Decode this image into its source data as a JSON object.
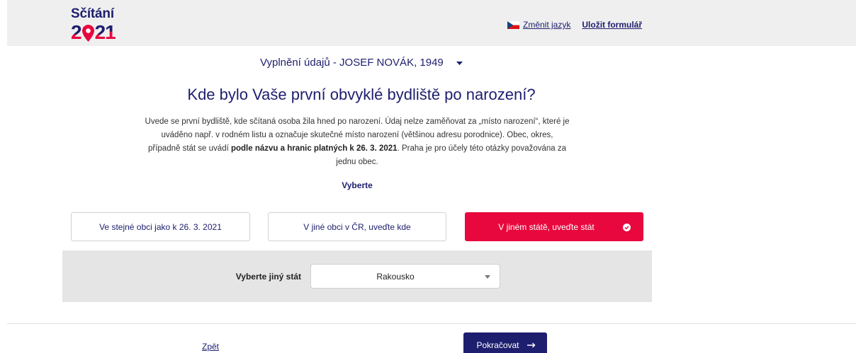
{
  "colors": {
    "primary": "#1e1e6e",
    "accent": "#e8083e",
    "panel": "#e5e5e5",
    "header": "#efefef"
  },
  "header": {
    "logo": {
      "title": "Sčítání",
      "year_digits": [
        "2",
        "0",
        "2",
        "1"
      ],
      "pin_icon": "location-pin-icon"
    },
    "language_icon": "czech-flag-icon",
    "change_language_label": "Změnit jazyk",
    "save_form_label": "Uložit formulář"
  },
  "respondent": {
    "label": "Vyplnění údajů - JOSEF NOVÁK, 1949",
    "icon": "caret-down-icon"
  },
  "question": {
    "title": "Kde bylo Vaše první obvyklé bydliště po narození?",
    "description": {
      "line1": "Uvede se první bydliště, kde sčítaná osoba žila hned po narození. Údaj nelze zaměňovat za „místo narození“, které je",
      "line2": "uváděno např. v rodném listu a označuje skutečné místo narození (většinou adresu porodnice). Obec, okres,",
      "line3_start": "případně stát se uvádí ",
      "line3_bold": "podle názvu a hranic platných k 26. 3. 2021",
      "line3_end": ". Praha je pro účely této otázky považována za",
      "line4": "jednu obec."
    },
    "prompt": "Vyberte"
  },
  "options": [
    {
      "label": "Ve stejné obci jako k 26. 3. 2021",
      "selected": false
    },
    {
      "label": "V jiné obci v ČR, uveďte kde",
      "selected": false
    },
    {
      "label": "V jiném státě, uveďte stát",
      "selected": true,
      "icon": "check-circle-icon"
    }
  ],
  "country_select": {
    "label": "Vyberte jiný stát",
    "value": "Rakousko",
    "icon": "caret-down-icon"
  },
  "footer": {
    "back_label": "Zpět",
    "continue_label": "Pokračovat",
    "continue_icon": "arrow-right-icon"
  }
}
